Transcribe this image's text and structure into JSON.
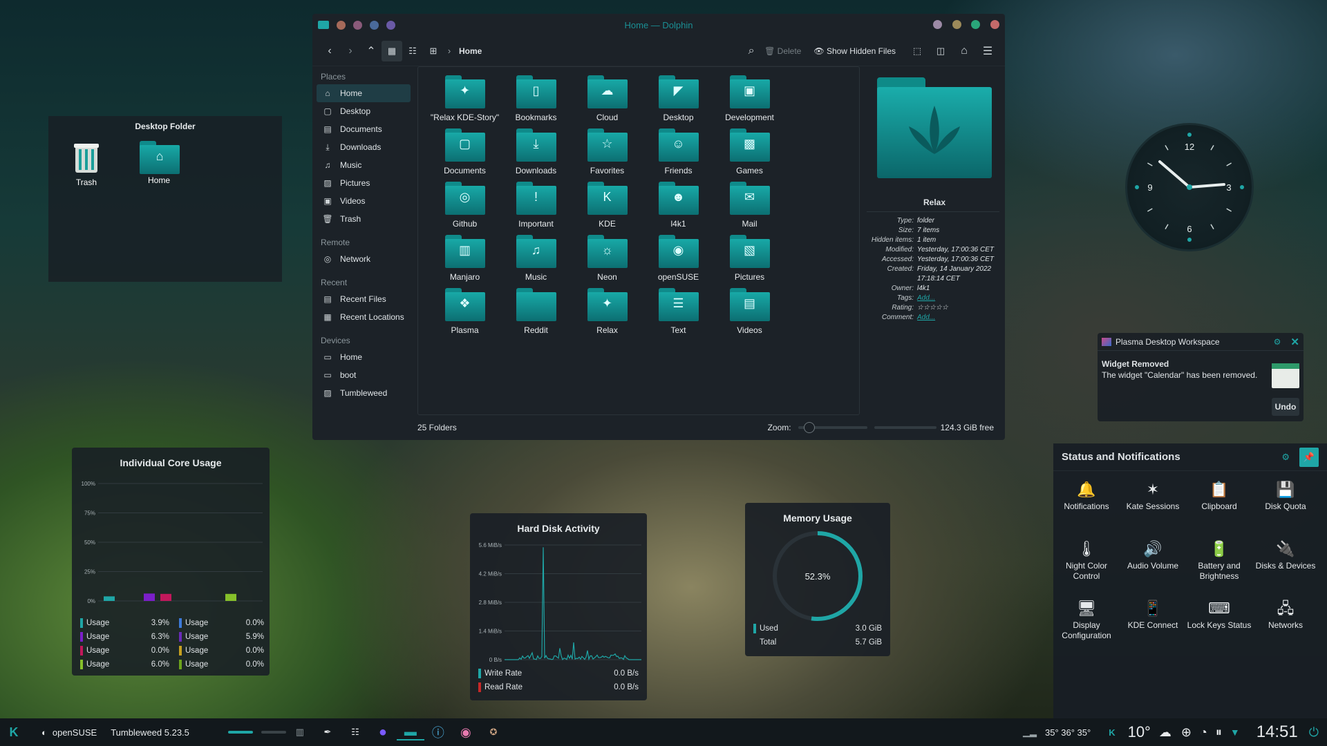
{
  "desktop_folder": {
    "title": "Desktop Folder",
    "items": [
      {
        "label": "Trash"
      },
      {
        "label": "Home"
      }
    ]
  },
  "dolphin": {
    "title": "Home — Dolphin",
    "breadcrumb": "Home",
    "toolbar": {
      "delete": "Delete",
      "show_hidden": "Show Hidden Files"
    },
    "places_header": "Places",
    "places": [
      "Home",
      "Desktop",
      "Documents",
      "Downloads",
      "Music",
      "Pictures",
      "Videos",
      "Trash"
    ],
    "remote_header": "Remote",
    "remote": [
      "Network"
    ],
    "recent_header": "Recent",
    "recent": [
      "Recent Files",
      "Recent Locations"
    ],
    "devices_header": "Devices",
    "devices": [
      "Home",
      "boot",
      "Tumbleweed"
    ],
    "files": [
      "\"Relax KDE-Story\"",
      "Bookmarks",
      "Cloud",
      "Desktop",
      "Development",
      "Documents",
      "Downloads",
      "Favorites",
      "Friends",
      "Games",
      "Github",
      "Important",
      "KDE",
      "l4k1",
      "Mail",
      "Manjaro",
      "Music",
      "Neon",
      "openSUSE",
      "Pictures",
      "Plasma",
      "Reddit",
      "Relax",
      "Text",
      "Videos"
    ],
    "status": {
      "count": "25 Folders",
      "zoom_label": "Zoom:",
      "zoom_value": 0.1,
      "free": "124.3 GiB free"
    },
    "info": {
      "name": "Relax",
      "rows": [
        {
          "k": "Type:",
          "v": "folder"
        },
        {
          "k": "Size:",
          "v": "7 items"
        },
        {
          "k": "Hidden items:",
          "v": "1 item"
        },
        {
          "k": "Modified:",
          "v": "Yesterday, 17:00:36 CET"
        },
        {
          "k": "Accessed:",
          "v": "Yesterday, 17:00:36 CET"
        },
        {
          "k": "Created:",
          "v": "Friday, 14 January 2022 17:18:14 CET"
        },
        {
          "k": "Owner:",
          "v": "l4k1"
        },
        {
          "k": "Tags:",
          "v": "Add..."
        },
        {
          "k": "Rating:",
          "v": "☆☆☆☆☆"
        },
        {
          "k": "Comment:",
          "v": "Add..."
        }
      ]
    }
  },
  "core": {
    "title": "Individual Core Usage",
    "ticks": [
      "100%",
      "75%",
      "50%",
      "25%",
      "0%"
    ],
    "rows": [
      {
        "l": "Usage",
        "v": "3.9%",
        "c": "#1fa6a6",
        "l2": "Usage",
        "v2": "0.0%",
        "c2": "#3d7ad8"
      },
      {
        "l": "Usage",
        "v": "6.3%",
        "c": "#7b1fc9",
        "l2": "Usage",
        "v2": "5.9%",
        "c2": "#6a2bb8"
      },
      {
        "l": "Usage",
        "v": "0.0%",
        "c": "#c2185b",
        "l2": "Usage",
        "v2": "0.0%",
        "c2": "#c6a020"
      },
      {
        "l": "Usage",
        "v": "6.0%",
        "c": "#86c02a",
        "l2": "Usage",
        "v2": "0.0%",
        "c2": "#6ca31c"
      }
    ]
  },
  "hdd": {
    "title": "Hard Disk Activity",
    "ticks": [
      "5.6 MiB/s",
      "4.2 MiB/s",
      "2.8 MiB/s",
      "1.4 MiB/s",
      "0 B/s"
    ],
    "write_label": "Write Rate",
    "write_value": "0.0 B/s",
    "read_label": "Read Rate",
    "read_value": "0.0 B/s"
  },
  "mem": {
    "title": "Memory Usage",
    "percent": "52.3%",
    "fraction": 0.523,
    "used_label": "Used",
    "used": "3.0 GiB",
    "total_label": "Total",
    "total": "5.7 GiB"
  },
  "notification": {
    "app": "Plasma Desktop Workspace",
    "title": "Widget Removed",
    "body": "The widget \"Calendar\" has been removed.",
    "action": "Undo"
  },
  "status": {
    "title": "Status and Notifications",
    "items": [
      "Notifications",
      "Kate Sessions",
      "Clipboard",
      "Disk Quota",
      "Night Color Control",
      "Audio Volume",
      "Battery and Brightness",
      "Disks & Devices",
      "Display Configuration",
      "KDE Connect",
      "Lock Keys Status",
      "Networks"
    ]
  },
  "clock": {
    "n12": "12",
    "n3": "3",
    "n6": "6",
    "n9": "9"
  },
  "taskbar": {
    "distro": "openSUSE",
    "version": "Tumbleweed 5.23.5",
    "temps": "35°  36°  35°",
    "weather": "10°",
    "time": "14:51"
  }
}
